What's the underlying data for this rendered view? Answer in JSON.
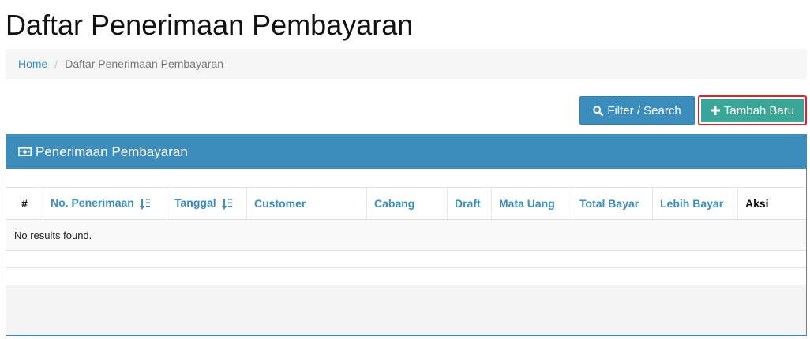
{
  "page": {
    "title": "Daftar Penerimaan Pembayaran"
  },
  "breadcrumb": {
    "home": "Home",
    "separator": "/",
    "current": "Daftar Penerimaan Pembayaran"
  },
  "toolbar": {
    "filter_label": "Filter / Search",
    "add_label": "Tambah Baru",
    "filter_icon": "search-icon",
    "add_icon": "plus-icon"
  },
  "panel": {
    "title": "Penerimaan Pembayaran",
    "icon": "money-icon",
    "columns": [
      "#",
      "No. Penerimaan",
      "Tanggal",
      "Customer",
      "Cabang",
      "Draft",
      "Mata Uang",
      "Total Bayar",
      "Lebih Bayar",
      "Aksi"
    ],
    "empty_message": "No results found."
  },
  "colors": {
    "primary": "#3c8dbc",
    "success": "#3aa698",
    "highlight": "#d9232d"
  }
}
